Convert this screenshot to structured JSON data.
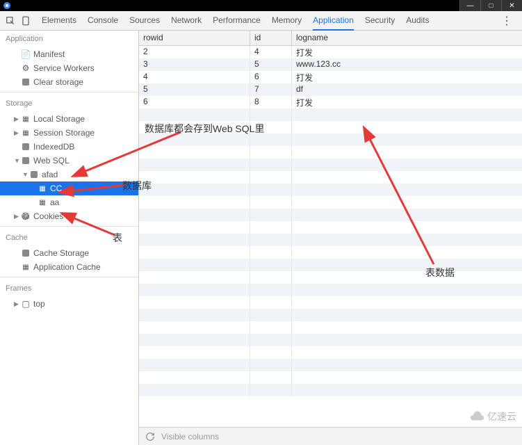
{
  "titlebar": {
    "min": "—",
    "max": "□",
    "close": "✕"
  },
  "toolbar": {
    "tabs": [
      "Elements",
      "Console",
      "Sources",
      "Network",
      "Performance",
      "Memory",
      "Application",
      "Security",
      "Audits"
    ],
    "active_index": 6
  },
  "sidebar": {
    "sections": {
      "application": {
        "title": "Application",
        "items": [
          "Manifest",
          "Service Workers",
          "Clear storage"
        ]
      },
      "storage": {
        "title": "Storage",
        "local": "Local Storage",
        "session": "Session Storage",
        "indexed": "IndexedDB",
        "websql": "Web SQL",
        "db": "afad",
        "table_cc": "CC",
        "table_aa": "aa",
        "cookies": "Cookies"
      },
      "cache": {
        "title": "Cache",
        "items": [
          "Cache Storage",
          "Application Cache"
        ]
      },
      "frames": {
        "title": "Frames",
        "top": "top"
      }
    }
  },
  "table": {
    "headers": [
      "rowid",
      "id",
      "logname"
    ],
    "rows": [
      {
        "rowid": "2",
        "id": "4",
        "logname": "打发"
      },
      {
        "rowid": "3",
        "id": "5",
        "logname": "www.123.cc"
      },
      {
        "rowid": "4",
        "id": "6",
        "logname": "打发"
      },
      {
        "rowid": "5",
        "id": "7",
        "logname": "df"
      },
      {
        "rowid": "6",
        "id": "8",
        "logname": "打发"
      }
    ]
  },
  "footer": {
    "placeholder": "Visible columns"
  },
  "annotations": {
    "a1": "数据库都会存到Web SQL里",
    "a2": "数据库",
    "a3": "表",
    "a4": "表数据"
  },
  "watermark": "亿速云"
}
